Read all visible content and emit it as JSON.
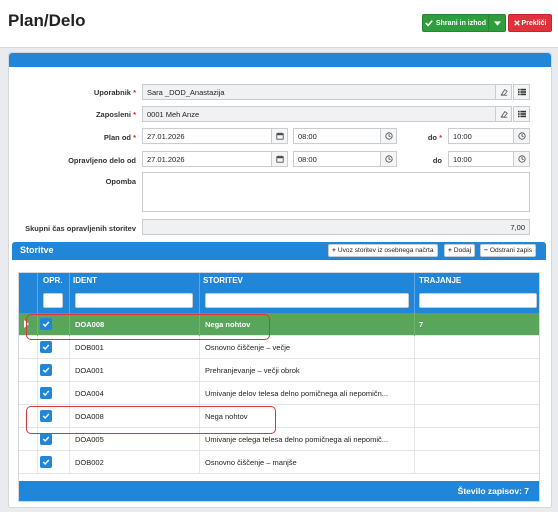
{
  "page": {
    "title": "Plan/Delo"
  },
  "toolbar": {
    "save_label": "Shrani in izhod",
    "cancel_label": "Prekliči"
  },
  "form": {
    "user_label": "Uporabnik",
    "user_value": "Sara _DOD_Anastazija",
    "employee_label": "Zaposleni",
    "employee_value": "0001 Meh Anze",
    "plan_label": "Plan od",
    "plan_date": "27.01.2026",
    "plan_time_from": "08:00",
    "plan_to_label": "do",
    "plan_time_to": "10:00",
    "done_label": "Opravljeno delo od",
    "done_date": "27.01.2026",
    "done_time_from": "08:00",
    "done_to_label": "do",
    "done_time_to": "10:00",
    "note_label": "Opomba",
    "note_value": "",
    "total_label": "Skupni čas opravljenih storitev",
    "total_value": "7,00",
    "required_mark": "*"
  },
  "services": {
    "title": "Storitve",
    "import_label": "Uvoz storitev iz osebnega načrta",
    "add_label": "Dodaj",
    "remove_label": "Odstrani zapis",
    "columns": {
      "opr": "OPR.",
      "ident": "IDENT",
      "storitev": "STORITEV",
      "trajanje": "TRAJANJE"
    },
    "rows": [
      {
        "checked": true,
        "ident": "DOA008",
        "storitev": "Nega nohtov",
        "trajanje": "7",
        "selected": true
      },
      {
        "checked": true,
        "ident": "DOB001",
        "storitev": "Osnovno čiščenje – večje",
        "trajanje": ""
      },
      {
        "checked": true,
        "ident": "DOA001",
        "storitev": "Prehranjevanje – večji obrok",
        "trajanje": ""
      },
      {
        "checked": true,
        "ident": "DOA004",
        "storitev": "Umivanje delov telesa delno pomičnega ali nepomičn...",
        "trajanje": ""
      },
      {
        "checked": true,
        "ident": "DOA008",
        "storitev": "Nega nohtov",
        "trajanje": ""
      },
      {
        "checked": true,
        "ident": "DOA005",
        "storitev": "Umivanje celega telesa delno pomičnega ali nepomič...",
        "trajanje": ""
      },
      {
        "checked": true,
        "ident": "DOB002",
        "storitev": "Osnovno čiščenje – manjše",
        "trajanje": ""
      }
    ],
    "footer": "Število zapisov: 7"
  },
  "colors": {
    "brand_blue": "#2286d8",
    "save_green": "#2e9d3c",
    "cancel_red": "#e0323b",
    "selected_row": "#5aa55c",
    "highlight": "#d9353b"
  }
}
